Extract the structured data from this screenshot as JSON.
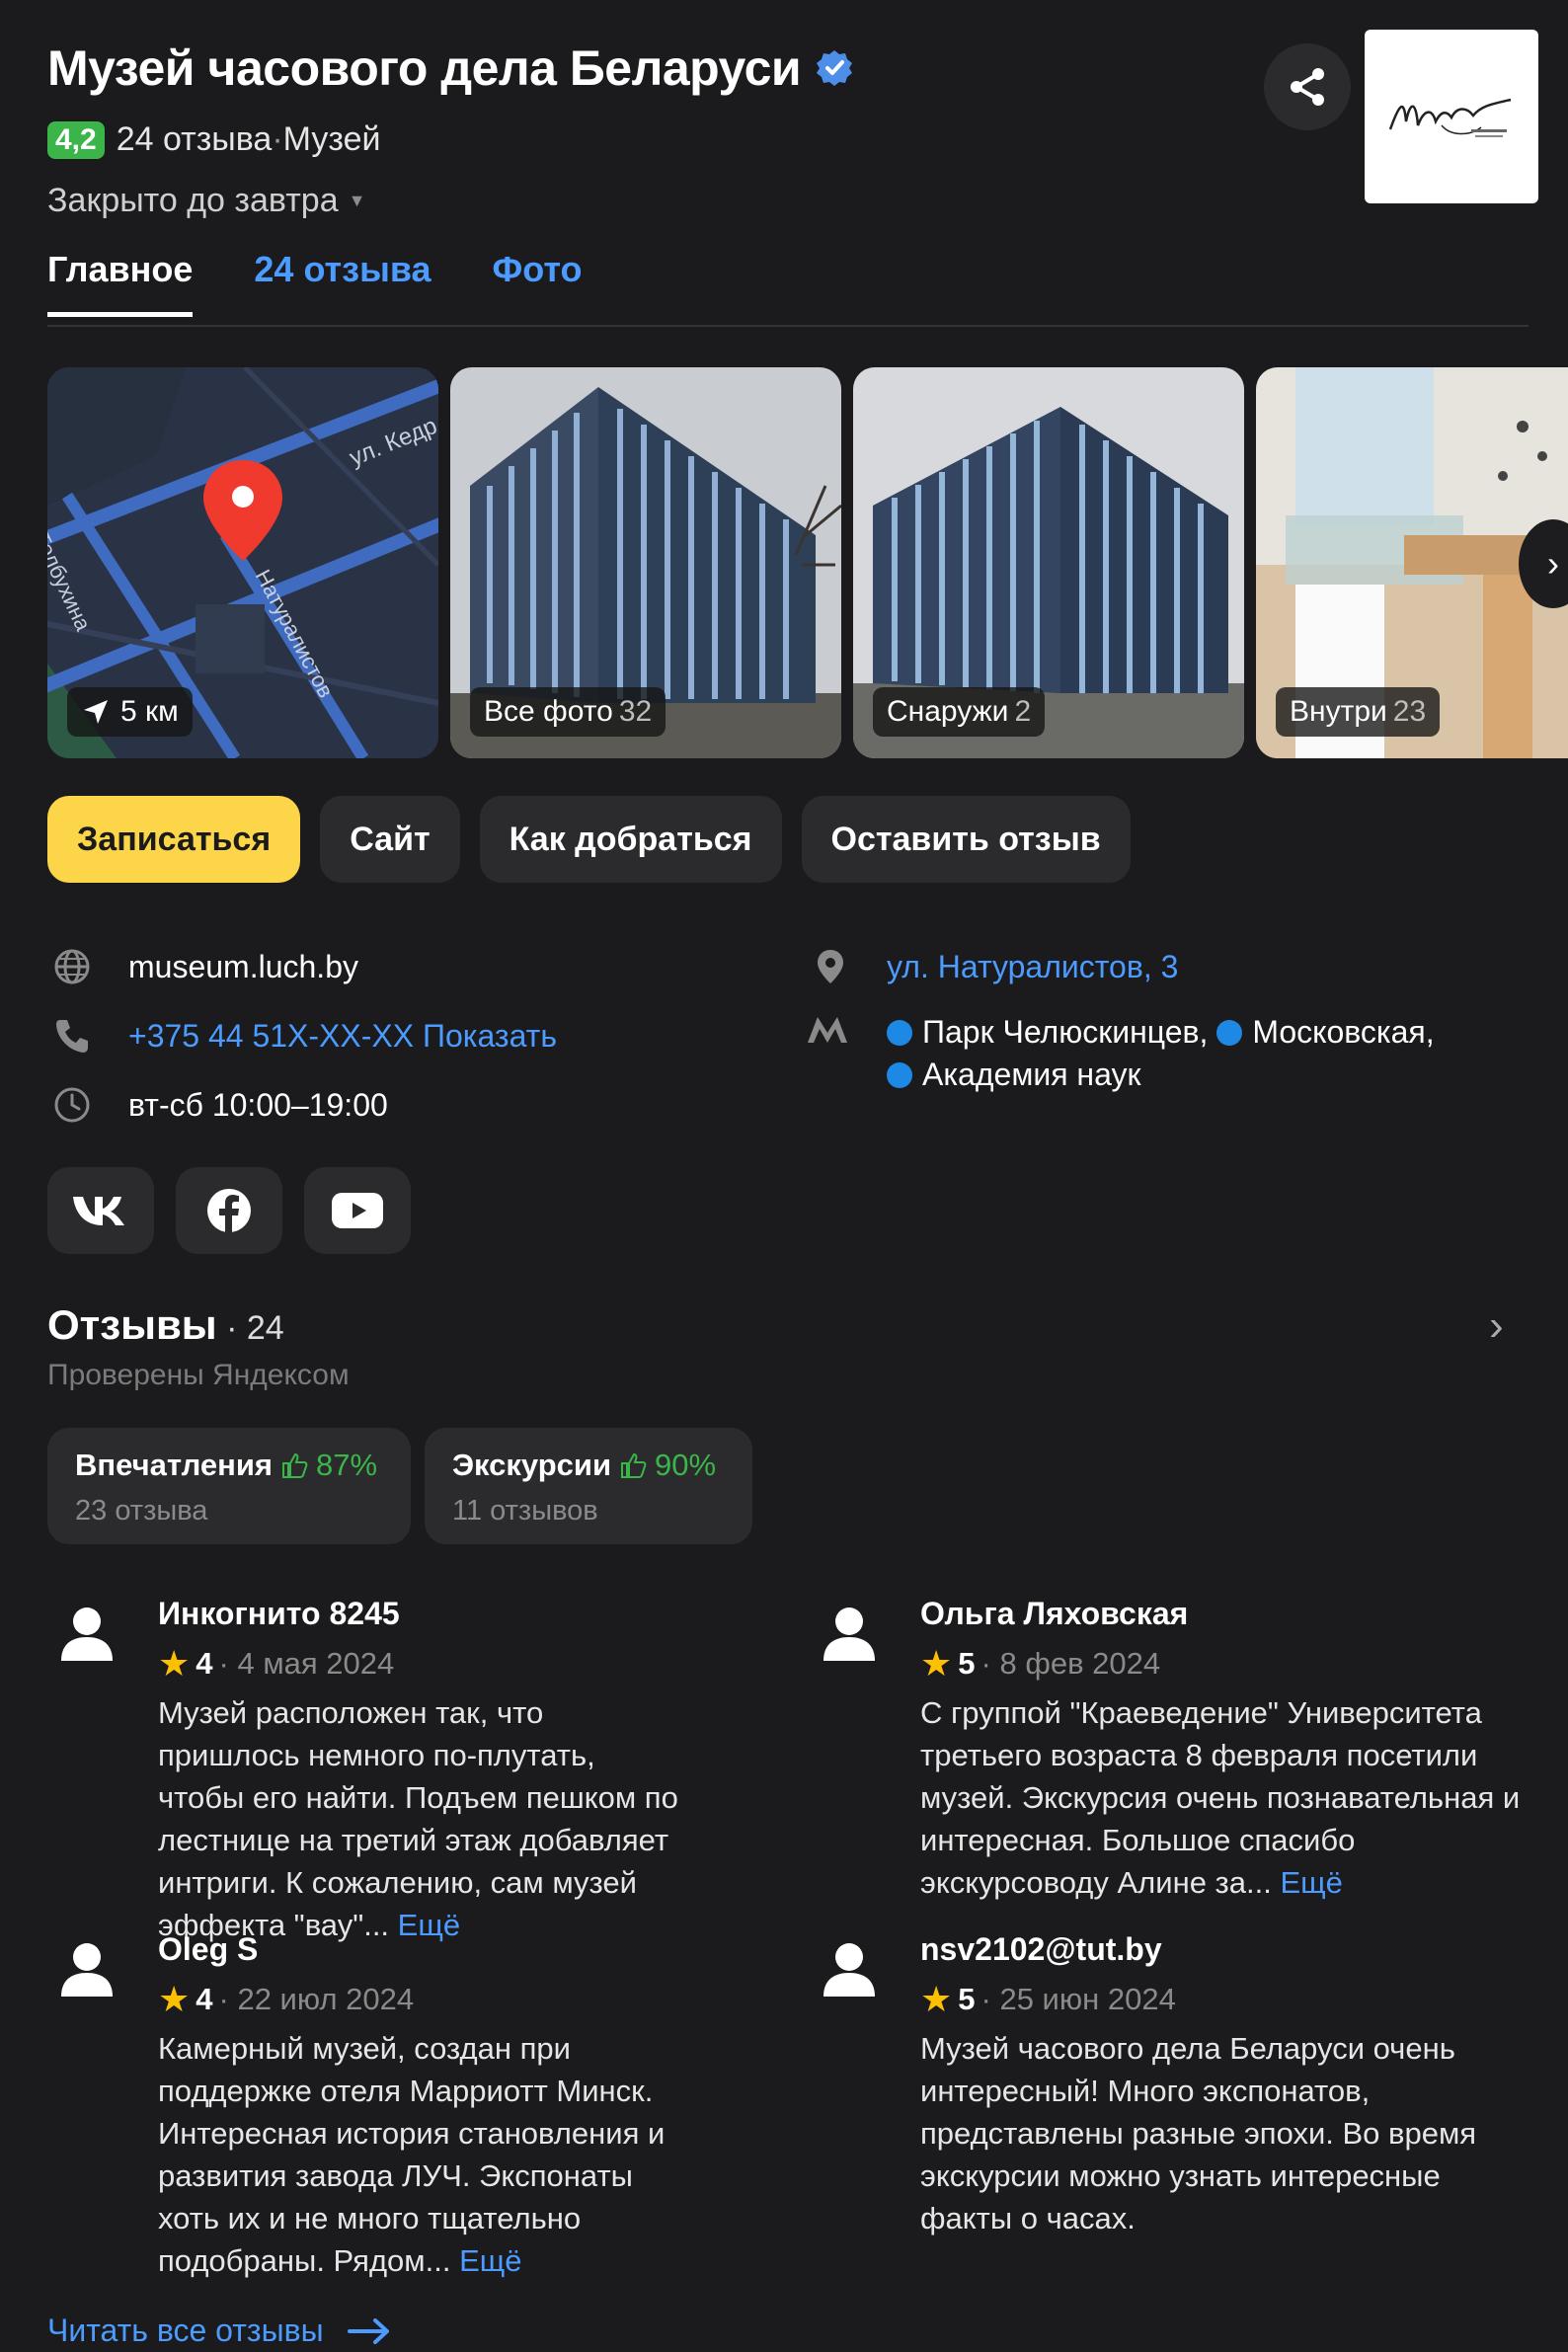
{
  "header": {
    "title": "Музей часового дела Беларуси",
    "rating": "4,2",
    "reviews_count_text": "24 отзыва",
    "separator": " · ",
    "category": "Музей",
    "status": "Закрыто до завтра"
  },
  "tabs": [
    {
      "label": "Главное",
      "active": true
    },
    {
      "label": "24 отзыва",
      "active": false
    },
    {
      "label": "Фото",
      "active": false
    }
  ],
  "gallery": {
    "map": {
      "streets": [
        "ул. Кедр",
        "ул. Толбухина",
        "Натуралистов"
      ],
      "distance": "5 км"
    },
    "tiles": [
      {
        "label": "Все фото",
        "count": "32"
      },
      {
        "label": "Снаружи",
        "count": "2"
      },
      {
        "label": "Внутри",
        "count": "23"
      }
    ]
  },
  "actions": {
    "book": "Записаться",
    "site": "Сайт",
    "route": "Как добраться",
    "review": "Оставить отзыв"
  },
  "contacts": {
    "website": "museum.luch.by",
    "phone": "+375 44 51X-XX-XX",
    "phone_show": "Показать",
    "hours": "вт-сб 10:00–19:00",
    "address": "ул. Натуралистов, 3",
    "metro": [
      "Парк Челюскинцев,",
      "Московская,",
      "Академия наук"
    ]
  },
  "social": [
    "vk-icon",
    "facebook-icon",
    "youtube-icon"
  ],
  "reviews": {
    "title": "Отзывы",
    "count": " · 24",
    "verified_by": "Проверены Яндексом",
    "aspects": [
      {
        "name": "Впечатления",
        "percent": "87%",
        "sub": "23 отзыва"
      },
      {
        "name": "Экскурсии",
        "percent": "90%",
        "sub": "11 отзывов"
      }
    ],
    "items": [
      {
        "author": "Инкогнито 8245",
        "score": "4",
        "date": "· 4 мая 2024",
        "text": "Музей расположен так, что пришлось немного по-плутать, чтобы его найти. Подъем пешком по лестнице на третий этаж добавляет интриги. К сожалению, сам музей эффекта \"вау\"...",
        "more": "Ещё"
      },
      {
        "author": "Ольга Ляховская",
        "score": "5",
        "date": "· 8 фев 2024",
        "text": "С группой \"Краеведение\" Университета третьего возраста 8 февраля посетили музей. Экскурсия очень познавательная и интересная. Большое спасибо экскурсоводу Алине за...",
        "more": "Ещё"
      },
      {
        "author": "Oleg S",
        "score": "4",
        "date": "· 22 июл 2024",
        "text": "Камерный музей, создан при поддержке отеля Марриотт Минск. Интересная история становления и развития завода ЛУЧ. Экспонаты хоть их и не много тщательно подобраны. Рядом...",
        "more": "Ещё"
      },
      {
        "author": "nsv2102@tut.by",
        "score": "5",
        "date": "· 25 июн 2024",
        "text": "Музей часового дела Беларуси очень интересный! Много экспонатов, представлены разные эпохи. Во время экскурсии можно узнать интересные факты о часах.",
        "more": ""
      }
    ],
    "read_all": "Читать все отзывы"
  },
  "colors": {
    "background": "#1b1b1d",
    "accent": "#4c9bff",
    "primary_button": "#fcd549",
    "rating_green": "#3bb54a",
    "star": "#fcc000"
  }
}
